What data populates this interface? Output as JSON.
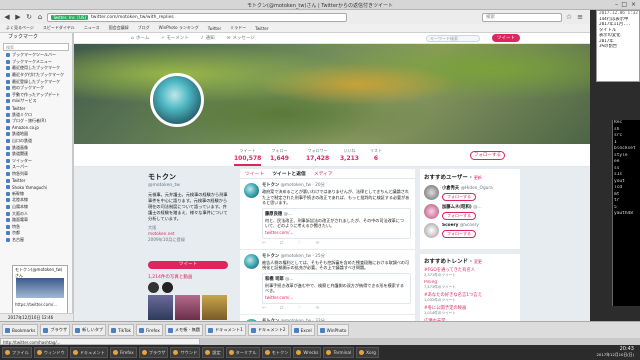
{
  "window": {
    "title": "モトクン(@motoken_tw)さん | Twitterからの返信付きツイート"
  },
  "browser": {
    "secure_badge": "Twitter, Inc. [US]",
    "url": "twitter.com/motoken_tw/with_replies",
    "search_placeholder": "検索",
    "bookmarks": [
      "よく見るページ",
      "スピードダイヤル",
      "ニュース",
      "国会会議録",
      "ブログ",
      "WinPhoto ランキング",
      "Twitter",
      "ミラドー",
      "Twitter"
    ]
  },
  "sidebar": {
    "title": "ブックマーク",
    "search_placeholder": "検索",
    "items": [
      "ブックマークツールバー",
      "ブックマークメニュー",
      "最近使用したブックマーク",
      "最近タグ付けたブックマーク",
      "最近登録したブックマーク",
      "他のブックマーク",
      "手動で作ったアップデート",
      "mixiサービス",
      "Twitter",
      "鉄道ミクロ",
      "ブログ・旅行者(R)",
      "Amazon.co.jp",
      "鉄道地図",
      "山口の鉄道",
      "鉄道画像",
      "鉄道関連",
      "ツイッター",
      "スーパー",
      "特急列車",
      "Twitter",
      "Shoko Yamaguchi",
      "新幹線",
      "北陸本線",
      "山陽本線",
      "大阪の人",
      "路面電車",
      "特急",
      "京都",
      "名古屋"
    ],
    "tweet_window_title": "モトクン(@motoken_tw)さん",
    "tweet_window_url": "https://twitter.com/...",
    "download_label": "2017年12月10日 12:46"
  },
  "twitter": {
    "nav": [
      "ホーム",
      "モーメント",
      "通知",
      "メッセージ"
    ],
    "search_placeholder": "キーワード検索",
    "tweet_button": "ツイート",
    "stats": [
      {
        "label": "ツイート",
        "value": "100,578"
      },
      {
        "label": "フォロー",
        "value": "1,649"
      },
      {
        "label": "フォロワー",
        "value": "17,428"
      },
      {
        "label": "いいね",
        "value": "3,213"
      },
      {
        "label": "リスト",
        "value": "6"
      }
    ],
    "follow_button": "フォローする",
    "profile": {
      "name": "モトクン",
      "handle": "@motoken_tw",
      "bio": "元検事。元弁護士。元検事の経験から刑事事件を中心に語ります。元検事の経験から現在の司法制度について語っています。弁護士の経験を踏まえ、様々な事件について分析しています。",
      "location": "大阪",
      "site": "motoken.net",
      "joined": "2009年10月に登録",
      "tweet_to_button": "ツイート",
      "media_label": "1,214件の写真と動画"
    },
    "timeline_tabs": [
      "ツイート",
      "ツイートと返信",
      "メディア"
    ],
    "tweets": [
      {
        "name": "モトクン",
        "handle": "@motoken_tw · 20分",
        "text": "政府案で決めることが悪いわけではありませんが、法律としてきちんと議論された上で制定された刑事手続きの改正であれば、もっと批判的に検証する必要があると思います。",
        "quote_name": "藤原良徳",
        "quote_handle": "@...",
        "quote_text": "何と、民法改正、刑事訴訟法の改正がされましたが、その中の司法改革について、どのように考えるか聞きたい。",
        "link": "twitter.com/..."
      },
      {
        "name": "モトクン",
        "handle": "@motoken_tw · 25分",
        "text": "被告人側の権利としては、そもそも控訴審を含めた捜査段階における取調べの可視化と証拠開示の拡充が必要。その上で議論すべき問題。",
        "quote_name": "和橋 司郎",
        "quote_handle": "@...",
        "quote_text": "刑事手続き改革が進む中で、検察と弁護側の双方が納得できる形を模索するべき。",
        "link": "twitter.com/..."
      },
      {
        "name": "モトクン",
        "handle": "@motoken_tw · 33分",
        "text": "日本の捜査機関は少なくとも「有罪立証の確実性」を念頭に置いて",
        "quote_name": "",
        "quote_handle": "",
        "quote_text": "",
        "link": ""
      }
    ],
    "who_to_follow": {
      "title": "おすすめユーザー",
      "refresh": "更新",
      "users": [
        {
          "name": "小倉秀夫",
          "handle": "@Hideo_Ogura",
          "button": "フォローする"
        },
        {
          "name": "加藤ムネ(昭和)",
          "handle": "@...",
          "button": "フォローする"
        },
        {
          "name": "Scoery",
          "handle": "@Scoery",
          "button": "フォローする"
        }
      ]
    },
    "trends": {
      "title": "おすすめトレンド",
      "change": "変更",
      "items": [
        {
          "name": "#FGOを通ってきた有名人",
          "count": "2,371件のツイート"
        },
        {
          "name": "Pining",
          "count": "7,473件のツイート"
        },
        {
          "name": "#あなたの好きな名言1つ言え",
          "count": "1,032件のツイート"
        },
        {
          "name": "#冬に公開予定の映画",
          "count": "1,014件のツイート"
        },
        {
          "name": "広瀬ホ天堂",
          "count": ""
        },
        {
          "name": "#小文化話",
          "count": ""
        }
      ]
    }
  },
  "terminal_top": [
    "2017.12.06 1:32",
    "144行は表示中",
    "2017年11月...",
    "タイトル",
    "表示の変化",
    "2017年",
    "3%の割合"
  ],
  "terminal_right": [
    "Rec",
    "sh",
    "src",
    "1",
    "blockset",
    "style",
    "ee",
    "ss",
    "s1s",
    "yout",
    "lcd",
    "mt",
    "tr",
    "5",
    "yauth48"
  ],
  "taskbar_top": [
    "Bookmarks",
    "ブラウザ",
    "新しいタブ",
    "TikTok",
    "Firefox",
    "メモ帳 - 無題",
    "ドキュメント1",
    "ドキュメント2",
    "Excel",
    "WinPhoto"
  ],
  "status_url": "http://twitter.com/hashtag/...",
  "taskbar_bottom": [
    "ファイル",
    "ウィンドウ",
    "ドキュメント",
    "Firefox",
    "ブラウザ",
    "サウンド",
    "設定",
    "ターミナル",
    "モトクン",
    "Wrecks",
    "Terminal",
    "Xorg"
  ],
  "clock": {
    "time": "20:43",
    "date": "2017年12月10日(日)"
  }
}
